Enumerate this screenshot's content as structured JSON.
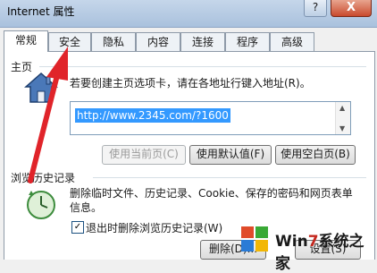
{
  "window": {
    "title": "Internet 属性",
    "help_label": "?",
    "close_label": "X"
  },
  "tabs": [
    "常规",
    "安全",
    "隐私",
    "内容",
    "连接",
    "程序",
    "高级"
  ],
  "home": {
    "group_title": "主页",
    "description": "若要创建主页选项卡，请在各地址行键入地址(R)。",
    "url": "http://www.2345.com/?1600",
    "buttons": [
      "使用当前页(C)",
      "使用默认值(F)",
      "使用空白页(B)"
    ]
  },
  "history": {
    "group_title": "浏览历史记录",
    "description": "删除临时文件、历史记录、Cookie、保存的密码和网页表单信息。",
    "checkbox_label": "退出时删除浏览历史记录(W)",
    "checkbox_checked": true,
    "delete_label": "删除(D)...",
    "settings_label": "设置(S)"
  },
  "watermark": {
    "text_a": "Win",
    "text_num": "7",
    "text_b": "系统之家"
  },
  "colors": {
    "arrow": "#e0242a",
    "selection": "#3399ff"
  }
}
